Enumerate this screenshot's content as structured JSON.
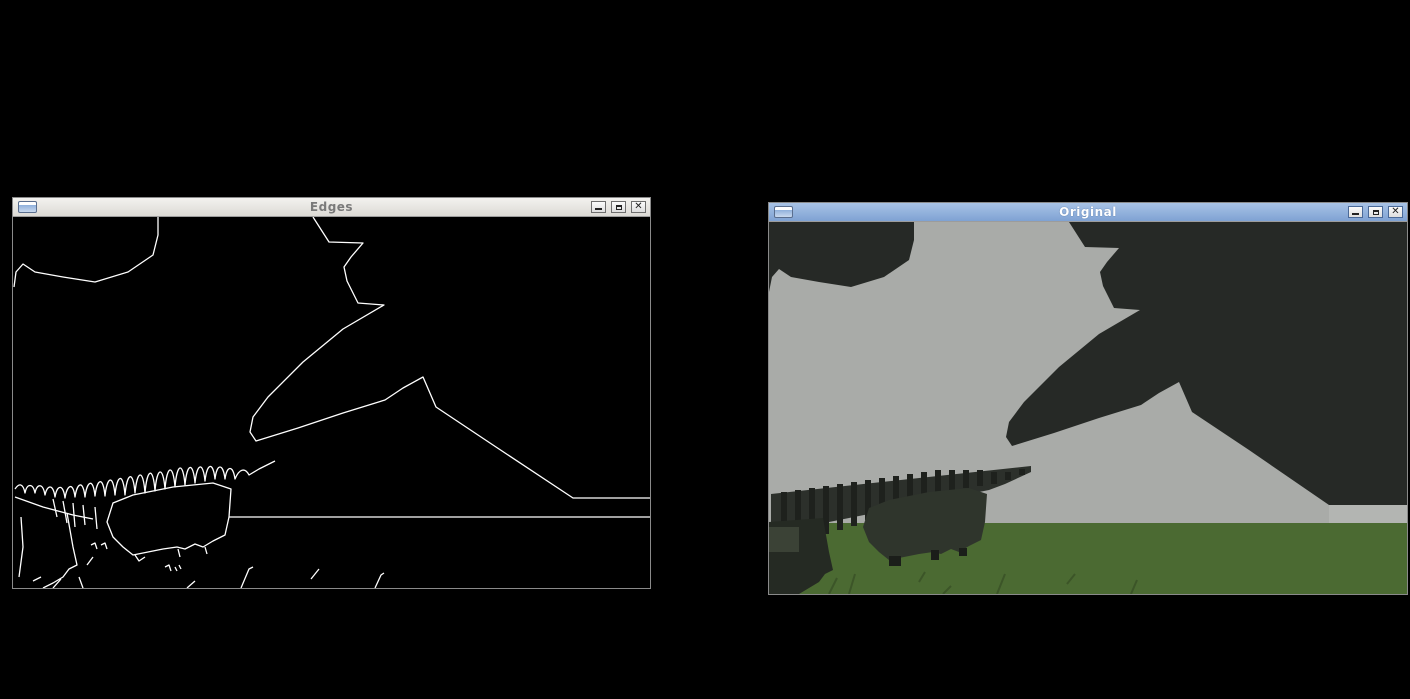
{
  "windows": {
    "edges": {
      "title": "Edges",
      "controls": {
        "minimize": "minimize",
        "maximize": "maximize",
        "close": "close"
      }
    },
    "original": {
      "title": "Original",
      "controls": {
        "minimize": "minimize",
        "maximize": "maximize",
        "close": "close"
      }
    }
  },
  "colors": {
    "desktop_background": "#000000",
    "edge_lines": "#ffffff",
    "sky": "#a9aba8",
    "dark_object": "#262926",
    "ground": "#4b6a32",
    "active_titlebar": "#8fb0dc",
    "inactive_titlebar": "#e6e4df"
  },
  "icons": {
    "window_menu": "window-menu-icon",
    "minimize": "minimize-icon",
    "maximize": "maximize-icon",
    "close": "close-icon"
  }
}
